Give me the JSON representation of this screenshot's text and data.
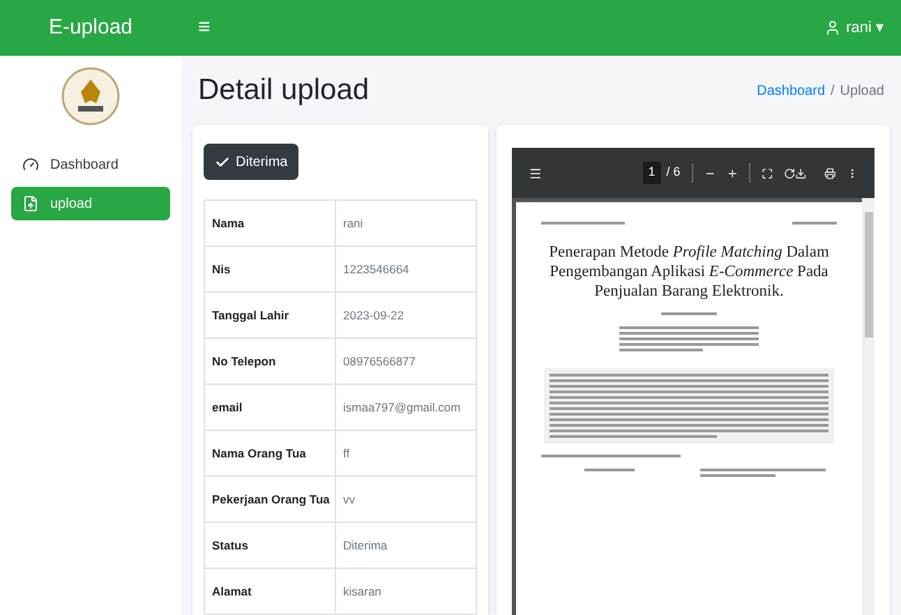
{
  "navbar": {
    "brand": "E-upload",
    "menu_icon": "≡",
    "user": "rani",
    "user_caret": "▾"
  },
  "sidebar": {
    "items": [
      {
        "label": "Dashboard",
        "selected": false,
        "kind": "dashboard"
      },
      {
        "label": "upload",
        "selected": true,
        "kind": "upload"
      }
    ]
  },
  "page": {
    "title": "Detail upload",
    "breadcrumb_separator": "/",
    "breadcrumb": [
      {
        "label": "Dashboard",
        "selected": false
      },
      {
        "label": "Upload",
        "selected": true
      }
    ]
  },
  "status_button": "Diterima",
  "details": [
    {
      "label": "Nama",
      "value": "rani"
    },
    {
      "label": "Nis",
      "value": "1223546664"
    },
    {
      "label": "Tanggal Lahir",
      "value": "2023-09-22"
    },
    {
      "label": "No Telepon",
      "value": "08976566877"
    },
    {
      "label": "email",
      "value": "ismaa797@gmail.com"
    },
    {
      "label": "Nama Orang Tua",
      "value": "ff"
    },
    {
      "label": "Pekerjaan Orang Tua",
      "value": "vv"
    },
    {
      "label": "Status",
      "value": "Diterima"
    },
    {
      "label": "Alamat",
      "value": "kisaran"
    }
  ],
  "pdf_viewer": {
    "page": "1",
    "page_count": "/ 6",
    "document_title": "Penerapan Metode *Profile Matching* Dalam Pengembangan Aplikasi *E-Commerce* Pada Penjualan Barang Elektronik."
  }
}
